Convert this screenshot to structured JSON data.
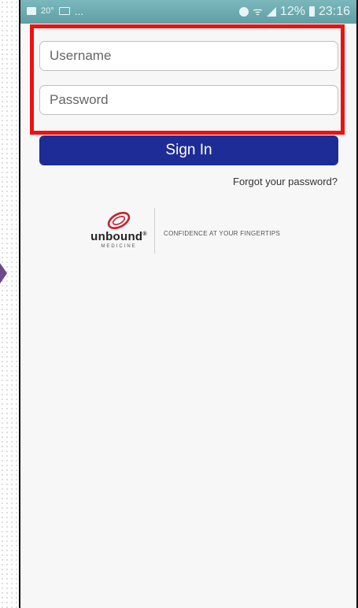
{
  "status_bar": {
    "left_text": "20°",
    "ellipsis": "...",
    "battery_percent": "12%",
    "time": "23:16"
  },
  "login": {
    "username_placeholder": "Username",
    "password_placeholder": "Password",
    "sign_in_label": "Sign In",
    "forgot_label": "Forgot your password?"
  },
  "branding": {
    "logo_text": "unbound",
    "logo_mark": "®",
    "logo_sub": "MEDICINE",
    "tagline": "CONFIDENCE AT YOUR FINGERTIPS"
  },
  "colors": {
    "status_bar": "#6aa9ae",
    "sign_in_button": "#1d2c96",
    "highlight_box": "#ee1111",
    "logo_swoosh": "#c8202f"
  }
}
